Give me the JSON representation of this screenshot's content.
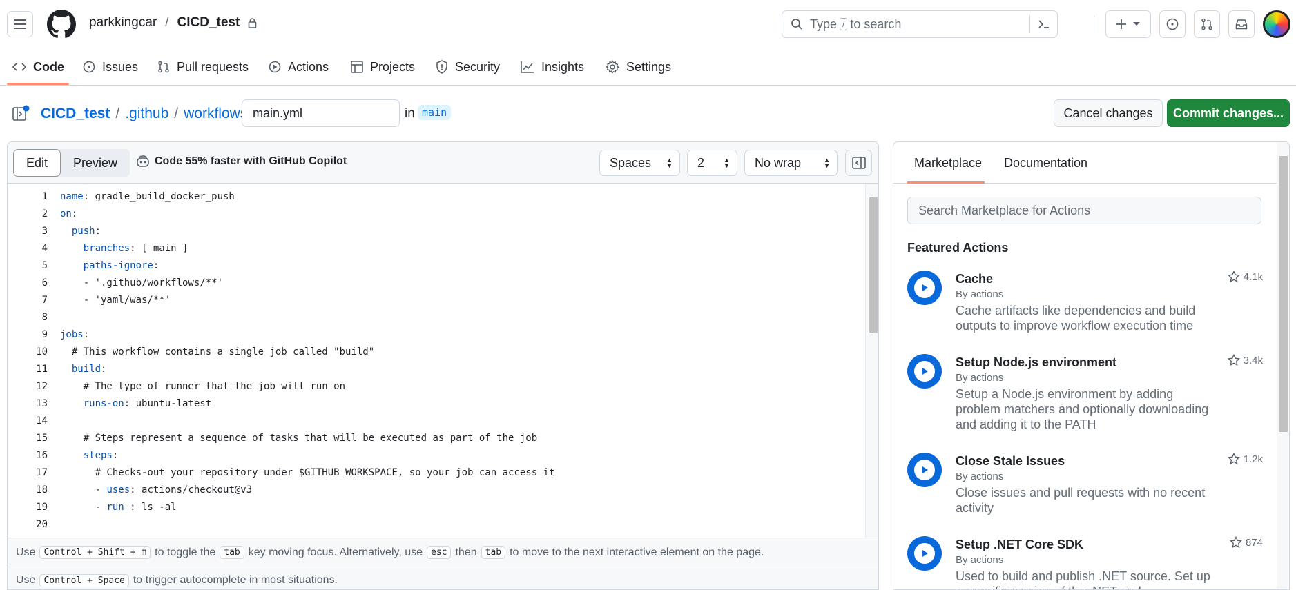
{
  "header": {
    "owner": "parkkingcar",
    "separator": "/",
    "repo": "CICD_test",
    "search_placeholder_pre": "Type",
    "search_placeholder_key": "/",
    "search_placeholder_post": "to search"
  },
  "repo_nav": {
    "tabs": [
      {
        "label": "Code",
        "icon": "code-icon"
      },
      {
        "label": "Issues",
        "icon": "issue-opened-icon"
      },
      {
        "label": "Pull requests",
        "icon": "git-pull-request-icon"
      },
      {
        "label": "Actions",
        "icon": "play-icon"
      },
      {
        "label": "Projects",
        "icon": "table-icon"
      },
      {
        "label": "Security",
        "icon": "shield-icon"
      },
      {
        "label": "Insights",
        "icon": "graph-icon"
      },
      {
        "label": "Settings",
        "icon": "gear-icon"
      }
    ]
  },
  "path": {
    "repo": "CICD_test",
    "dir1": ".github",
    "dir2": "workflows",
    "sep": "/",
    "filename": "main.yml",
    "in_text": "in",
    "branch": "main",
    "cancel_label": "Cancel changes",
    "commit_label": "Commit changes..."
  },
  "editor": {
    "edit_tab": "Edit",
    "preview_tab": "Preview",
    "copilot_text": "Code 55% faster with GitHub Copilot",
    "indent_mode": "Spaces",
    "indent_size": "2",
    "wrap_mode": "No wrap",
    "lines": [
      {
        "n": "1",
        "key": "name",
        "rest": ": gradle_build_docker_push",
        "indent": ""
      },
      {
        "n": "2",
        "key": "on",
        "rest": ":",
        "indent": ""
      },
      {
        "n": "3",
        "key": "push",
        "rest": ":",
        "indent": "  "
      },
      {
        "n": "4",
        "key": "branches",
        "rest": ": [ main ]",
        "indent": "    "
      },
      {
        "n": "5",
        "key": "paths-ignore",
        "rest": ":",
        "indent": "    "
      },
      {
        "n": "6",
        "key": "",
        "rest": "- '.github/workflows/**'",
        "indent": "    "
      },
      {
        "n": "7",
        "key": "",
        "rest": "- 'yaml/was/**'",
        "indent": "    "
      },
      {
        "n": "8",
        "key": "",
        "rest": "",
        "indent": ""
      },
      {
        "n": "9",
        "key": "jobs",
        "rest": ":",
        "indent": ""
      },
      {
        "n": "10",
        "key": "",
        "rest": "# This workflow contains a single job called \"build\"",
        "indent": "  "
      },
      {
        "n": "11",
        "key": "build",
        "rest": ":",
        "indent": "  "
      },
      {
        "n": "12",
        "key": "",
        "rest": "# The type of runner that the job will run on",
        "indent": "    "
      },
      {
        "n": "13",
        "key": "runs-on",
        "rest": ": ubuntu-latest",
        "indent": "    "
      },
      {
        "n": "14",
        "key": "",
        "rest": "",
        "indent": ""
      },
      {
        "n": "15",
        "key": "",
        "rest": "# Steps represent a sequence of tasks that will be executed as part of the job",
        "indent": "    "
      },
      {
        "n": "16",
        "key": "steps",
        "rest": ":",
        "indent": "    "
      },
      {
        "n": "17",
        "key": "",
        "rest": "# Checks-out your repository under $GITHUB_WORKSPACE, so your job can access it",
        "indent": "      "
      },
      {
        "n": "18",
        "key": "uses",
        "rest": ": actions/checkout@v3",
        "indent": "      - "
      },
      {
        "n": "19",
        "key": "run",
        "rest": " : ls -al",
        "indent": "      - "
      },
      {
        "n": "20",
        "key": "",
        "rest": "",
        "indent": ""
      }
    ],
    "hint1": {
      "use": "Use",
      "combo": "Control + Shift + m",
      "a": "to toggle the",
      "tab": "tab",
      "b": "key moving focus. Alternatively, use",
      "esc": "esc",
      "then": "then",
      "tab2": "tab",
      "c": "to move to the next interactive element on the page."
    },
    "hint2": {
      "use": "Use",
      "combo": "Control + Space",
      "rest": "to trigger autocomplete in most situations."
    }
  },
  "sidebar": {
    "tab_marketplace": "Marketplace",
    "tab_documentation": "Documentation",
    "search_placeholder": "Search Marketplace for Actions",
    "featured_title": "Featured Actions",
    "actions": [
      {
        "name": "Cache",
        "by": "By actions",
        "desc": "Cache artifacts like dependencies and build outputs to improve workflow execution time",
        "stars": "4.1k"
      },
      {
        "name": "Setup Node.js environment",
        "by": "By actions",
        "desc": "Setup a Node.js environment by adding problem matchers and optionally downloading and adding it to the PATH",
        "stars": "3.4k"
      },
      {
        "name": "Close Stale Issues",
        "by": "By actions",
        "desc": "Close issues and pull requests with no recent activity",
        "stars": "1.2k"
      },
      {
        "name": "Setup .NET Core SDK",
        "by": "By actions",
        "desc": "Used to build and publish .NET source. Set up a specific version of the .NET and authentication to private NuGet repository",
        "stars": "874"
      }
    ]
  },
  "colors": {
    "accent_link": "#0969da",
    "commit_green": "#1f883d",
    "underline_orange": "#fd8c73",
    "yaml_key": "#0550ae"
  }
}
